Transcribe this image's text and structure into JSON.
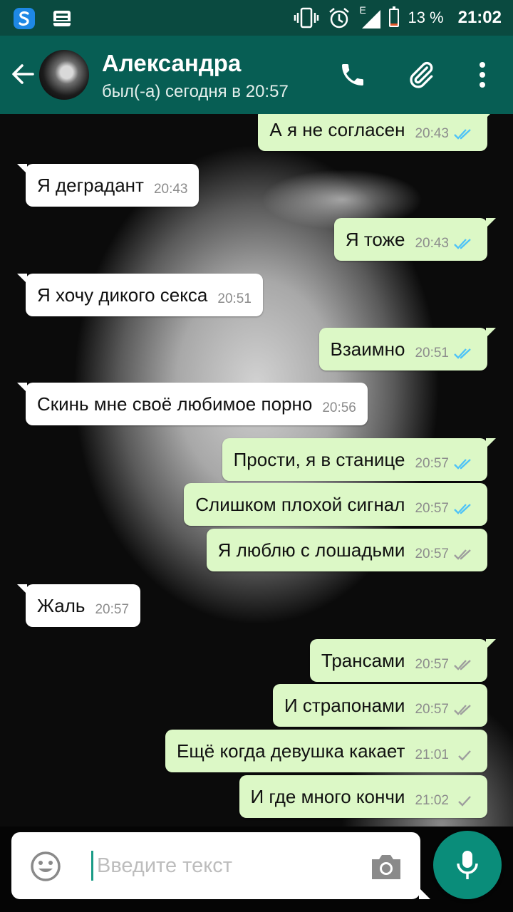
{
  "status_bar": {
    "network": "E",
    "battery": "13 %",
    "time": "21:02",
    "battery_level": 0.13,
    "icons": [
      "swiftkey-icon",
      "tray-icon",
      "vibrate-icon",
      "alarm-icon",
      "signal-icon",
      "battery-icon"
    ]
  },
  "header": {
    "contact_name": "Александра",
    "last_seen": "был(-а) сегодня в 20:57",
    "icons": [
      "back-arrow-icon",
      "avatar",
      "phone-icon",
      "paperclip-icon",
      "more-vert-icon"
    ]
  },
  "messages": [
    {
      "dir": "out",
      "text": "А я не согласен",
      "time": "20:43",
      "status": "read"
    },
    {
      "dir": "in",
      "text": "Я деградант",
      "time": "20:43"
    },
    {
      "dir": "out",
      "text": "Я тоже",
      "time": "20:43",
      "status": "read"
    },
    {
      "dir": "in",
      "text": "Я хочу дикого секса",
      "time": "20:51"
    },
    {
      "dir": "out",
      "text": "Взаимно",
      "time": "20:51",
      "status": "read"
    },
    {
      "dir": "in",
      "text": "Скинь мне своё любимое порно",
      "time": "20:56"
    },
    {
      "dir": "out",
      "text": "Прости, я в станице",
      "time": "20:57",
      "status": "read"
    },
    {
      "dir": "out",
      "text": "Слишком плохой сигнал",
      "time": "20:57",
      "status": "read"
    },
    {
      "dir": "out",
      "text": "Я люблю с лошадьми",
      "time": "20:57",
      "status": "delivered"
    },
    {
      "dir": "in",
      "text": "Жаль",
      "time": "20:57"
    },
    {
      "dir": "out",
      "text": "Трансами",
      "time": "20:57",
      "status": "delivered"
    },
    {
      "dir": "out",
      "text": "И страпонами",
      "time": "20:57",
      "status": "delivered"
    },
    {
      "dir": "out",
      "text": "Ещё когда девушка какает",
      "time": "21:01",
      "status": "sent"
    },
    {
      "dir": "out",
      "text": "И где много кончи",
      "time": "21:02",
      "status": "sent"
    }
  ],
  "input": {
    "placeholder": "Введите текст",
    "value": ""
  },
  "colors": {
    "header": "#075e54",
    "status_bar": "#0a4a40",
    "outgoing_bubble": "#dcf8c6",
    "incoming_bubble": "#ffffff",
    "read_ticks": "#4fc3f7",
    "unread_ticks": "#9e9e9e",
    "mic_button": "#0a8d7a"
  }
}
